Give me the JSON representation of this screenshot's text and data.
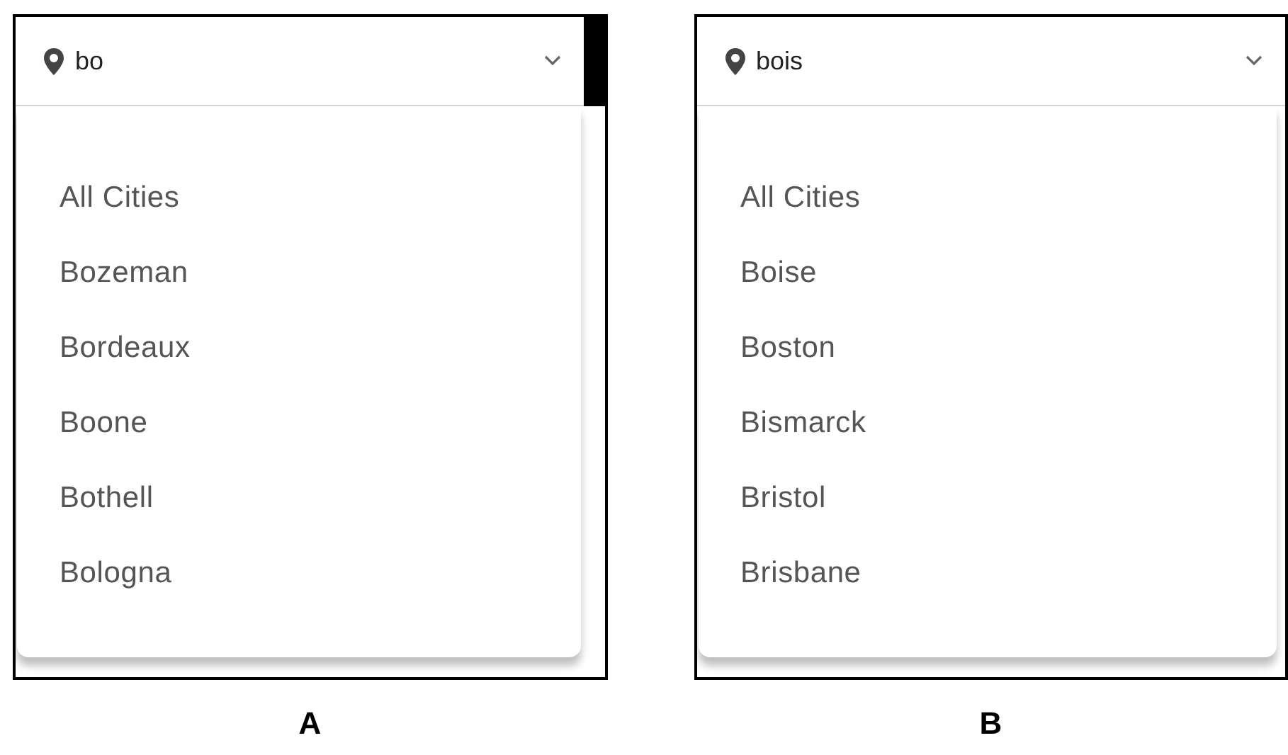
{
  "panels": [
    {
      "label": "A",
      "search": {
        "value": "bo"
      },
      "options": [
        "All Cities",
        "Bozeman",
        "Bordeaux",
        "Boone",
        "Bothell",
        "Bologna"
      ]
    },
    {
      "label": "B",
      "search": {
        "value": "bois"
      },
      "options": [
        "All Cities",
        "Boise",
        "Boston",
        "Bismarck",
        "Bristol",
        "Brisbane"
      ]
    }
  ]
}
